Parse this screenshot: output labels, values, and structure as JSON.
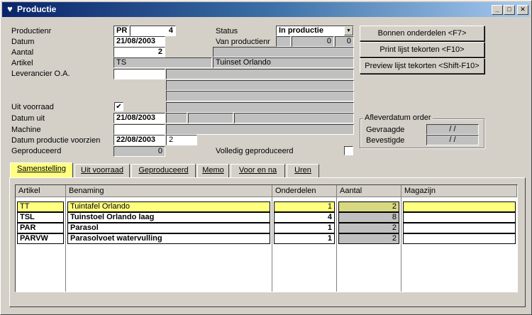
{
  "window": {
    "title": "Productie"
  },
  "form": {
    "productienr_label": "Productienr",
    "productienr_prefix": "PR",
    "productienr_value": "4",
    "datum_label": "Datum",
    "datum_value": "21/08/2003",
    "aantal_label": "Aantal",
    "aantal_value": "2",
    "artikel_label": "Artikel",
    "artikel_code": "TS",
    "artikel_name": "Tuinset Orlando",
    "leverancier_label": "Leverancier O.A.",
    "uit_voorraad_label": "Uit voorraad",
    "uit_voorraad_checked": "✔",
    "datum_uit_label": "Datum uit",
    "datum_uit_value": "21/08/2003",
    "machine_label": "Machine",
    "datum_voorzien_label": "Datum productie voorzien",
    "datum_voorzien_value": "22/08/2003",
    "datum_voorzien_extra": "2",
    "geproduceerd_label": "Geproduceerd",
    "geproduceerd_value": "0",
    "status_label": "Status",
    "status_value": "In productie",
    "van_productienr_label": "Van productienr",
    "van_productienr_a": "0",
    "van_productienr_b": "0",
    "volledig_label": "Volledig geproduceerd"
  },
  "buttons": {
    "bonnen": "Bonnen onderdelen  <F7>",
    "print": "Print lijst tekorten <F10>",
    "preview": "Preview lijst tekorten <Shift-F10>"
  },
  "afleverdatum": {
    "title": "Afleverdatum order",
    "gevraagde_label": "Gevraagde",
    "gevraagde_value": "/    /",
    "bevestigde_label": "Bevestigde",
    "bevestigde_value": "/    /"
  },
  "tabs": [
    {
      "label": "Samenstelling"
    },
    {
      "label": "Uit voorraad"
    },
    {
      "label": "Geproduceerd"
    },
    {
      "label": "Memo"
    },
    {
      "label": "Voor en na"
    },
    {
      "label": "Uren"
    }
  ],
  "grid": {
    "headers": [
      "Artikel",
      "Benaming",
      "Onderdelen",
      "Aantal",
      "Magazijn"
    ],
    "rows": [
      {
        "artikel": "TT",
        "benaming": "Tuintafel Orlando",
        "onderdelen": "1",
        "aantal": "2",
        "magazijn": ""
      },
      {
        "artikel": "TSL",
        "benaming": "Tuinstoel Orlando laag",
        "onderdelen": "4",
        "aantal": "8",
        "magazijn": ""
      },
      {
        "artikel": "PAR",
        "benaming": "Parasol",
        "onderdelen": "1",
        "aantal": "2",
        "magazijn": ""
      },
      {
        "artikel": "PARVW",
        "benaming": "Parasolvoet watervulling",
        "onderdelen": "1",
        "aantal": "2",
        "magazijn": ""
      }
    ]
  }
}
